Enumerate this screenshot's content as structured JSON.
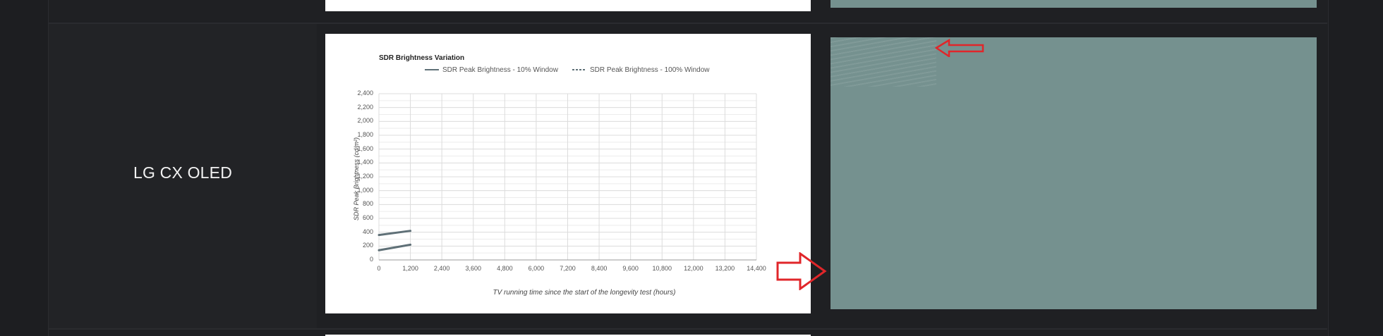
{
  "row": {
    "model_name": "LG CX OLED"
  },
  "chart": {
    "title": "SDR Brightness Variation",
    "legend": [
      "SDR Peak Brightness - 10% Window",
      "SDR Peak Brightness - 100% Window"
    ],
    "ylabel": "SDR Peak Brightness (cd/m²)",
    "xlabel": "TV running time since the start of the longevity test (hours)",
    "y_ticks": [
      "0",
      "200",
      "400",
      "600",
      "800",
      "1,000",
      "1,200",
      "1,400",
      "1,600",
      "1,800",
      "2,000",
      "2,200",
      "2,400"
    ],
    "x_ticks": [
      "0",
      "1,200",
      "2,400",
      "3,600",
      "4,800",
      "6,000",
      "7,200",
      "8,400",
      "9,600",
      "10,800",
      "12,000",
      "13,200",
      "14,400"
    ]
  },
  "chart_data": {
    "type": "line",
    "title": "SDR Brightness Variation",
    "xlabel": "TV running time since the start of the longevity test (hours)",
    "ylabel": "SDR Peak Brightness (cd/m²)",
    "xlim": [
      0,
      14400
    ],
    "ylim": [
      0,
      2400
    ],
    "grid": true,
    "legend_position": "top",
    "series": [
      {
        "name": "SDR Peak Brightness - 10% Window",
        "x": [
          0,
          1200
        ],
        "values": [
          360,
          420
        ]
      },
      {
        "name": "SDR Peak Brightness - 100% Window",
        "x": [
          0,
          1200
        ],
        "values": [
          140,
          220
        ]
      }
    ]
  },
  "colors": {
    "series_line": "#5f7077",
    "arrow": "#e0262a",
    "teal_panel": "#75918f",
    "background": "#1d1e21"
  },
  "icons": {
    "left_arrow": "arrow-left-icon",
    "right_arrow": "arrow-right-icon"
  }
}
